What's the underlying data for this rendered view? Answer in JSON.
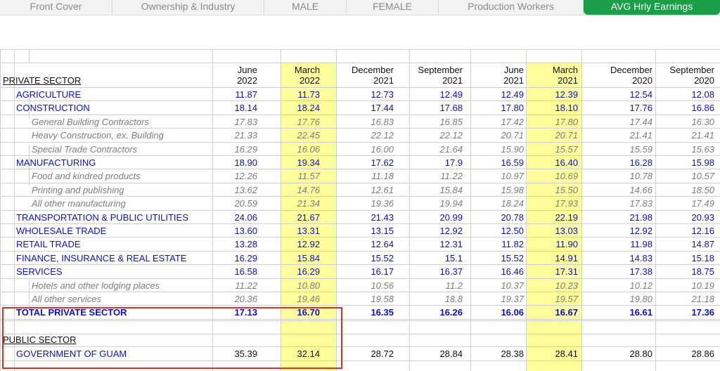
{
  "tabs": [
    {
      "label": "Front Cover",
      "active": false
    },
    {
      "label": "Ownership & Industry",
      "active": false
    },
    {
      "label": "MALE",
      "active": false
    },
    {
      "label": "FEMALE",
      "active": false
    },
    {
      "label": "Production Workers",
      "active": false
    },
    {
      "label": "AVG Hrly Earnings",
      "active": true
    }
  ],
  "sections": {
    "private": "PRIVATE SECTOR",
    "public": "PUBLIC SECTOR"
  },
  "columns": [
    {
      "month": "June",
      "year": "2022",
      "highlight": false
    },
    {
      "month": "March",
      "year": "2022",
      "highlight": true
    },
    {
      "month": "December",
      "year": "2021",
      "highlight": false
    },
    {
      "month": "September",
      "year": "2021",
      "highlight": false
    },
    {
      "month": "June",
      "year": "2021",
      "highlight": false
    },
    {
      "month": "March",
      "year": "2021",
      "highlight": true
    },
    {
      "month": "December",
      "year": "2020",
      "highlight": false
    },
    {
      "month": "September",
      "year": "2020",
      "highlight": false
    }
  ],
  "rows": [
    {
      "label": "AGRICULTURE",
      "style": "main",
      "values": [
        "11.87",
        "11.73",
        "12.73",
        "12.49",
        "12.49",
        "12.39",
        "12.54",
        "12.08"
      ]
    },
    {
      "label": "CONSTRUCTION",
      "style": "main",
      "values": [
        "18.14",
        "18.24",
        "17.44",
        "17.68",
        "17.80",
        "18.10",
        "17.76",
        "16.86"
      ]
    },
    {
      "label": "General Building Contractors",
      "style": "sub",
      "values": [
        "17.83",
        "17.76",
        "16.83",
        "16.85",
        "17.42",
        "17.80",
        "17.44",
        "16.30"
      ]
    },
    {
      "label": "Heavy Construction, ex. Building",
      "style": "sub",
      "values": [
        "21.33",
        "22.45",
        "22.12",
        "22.12",
        "20.71",
        "20.71",
        "21.41",
        "21.41"
      ]
    },
    {
      "label": "Special Trade Contractors",
      "style": "sub",
      "values": [
        "16.29",
        "16.06",
        "16.00",
        "21.64",
        "15.90",
        "15.57",
        "15.59",
        "15.63"
      ]
    },
    {
      "label": "MANUFACTURING",
      "style": "main",
      "values": [
        "18.90",
        "19.34",
        "17.62",
        "17.9",
        "16.59",
        "16.40",
        "16.28",
        "15.98"
      ]
    },
    {
      "label": "Food and kindred products",
      "style": "sub",
      "values": [
        "12.26",
        "11.57",
        "11.18",
        "11.22",
        "10.97",
        "10.69",
        "10.78",
        "10.57"
      ]
    },
    {
      "label": "Printing and publishing",
      "style": "sub",
      "values": [
        "13.62",
        "14.76",
        "12.61",
        "15.84",
        "15.98",
        "15.50",
        "14.66",
        "18.50"
      ]
    },
    {
      "label": "All other manufacturing",
      "style": "sub",
      "values": [
        "20.59",
        "21.34",
        "19.36",
        "19.94",
        "18.24",
        "17.93",
        "17.83",
        "17.49"
      ]
    },
    {
      "label": "TRANSPORTATION & PUBLIC UTILITIES",
      "style": "main",
      "values": [
        "24.06",
        "21.67",
        "21.43",
        "20.99",
        "20.78",
        "22.19",
        "21.98",
        "20.93"
      ]
    },
    {
      "label": "WHOLESALE TRADE",
      "style": "main",
      "values": [
        "13.60",
        "13.31",
        "13.15",
        "12.92",
        "12.50",
        "13.03",
        "12.92",
        "12.16"
      ]
    },
    {
      "label": "RETAIL TRADE",
      "style": "main",
      "values": [
        "13.28",
        "12.92",
        "12.64",
        "12.31",
        "11.82",
        "11.90",
        "11.98",
        "14.87"
      ]
    },
    {
      "label": "FINANCE, INSURANCE & REAL ESTATE",
      "style": "main",
      "values": [
        "16.29",
        "15.84",
        "15.52",
        "15.1",
        "15.52",
        "14.91",
        "14.83",
        "15.18"
      ]
    },
    {
      "label": "SERVICES",
      "style": "main",
      "values": [
        "16.58",
        "16.29",
        "16.17",
        "16.37",
        "16.46",
        "17.31",
        "17.38",
        "18.75"
      ]
    },
    {
      "label": "Hotels and other lodging places",
      "style": "sub",
      "values": [
        "11.22",
        "10.80",
        "10.56",
        "11.2",
        "10.37",
        "10.23",
        "10.12",
        "10.19"
      ]
    },
    {
      "label": "All other services",
      "style": "sub",
      "values": [
        "20.36",
        "19.46",
        "19.58",
        "18.8",
        "19.37",
        "19.57",
        "19.80",
        "21.18"
      ]
    },
    {
      "label": "TOTAL PRIVATE SECTOR",
      "style": "total",
      "values": [
        "17.13",
        "16.70",
        "16.35",
        "16.26",
        "16.06",
        "16.67",
        "16.61",
        "17.36"
      ]
    }
  ],
  "public_rows": [
    {
      "label": "GOVERNMENT OF GUAM",
      "style": "public",
      "values": [
        "35.39",
        "32.14",
        "28.72",
        "28.84",
        "28.38",
        "28.41",
        "28.80",
        "28.86"
      ]
    }
  ],
  "colors": {
    "highlight": "#fdfd9c",
    "active_tab": "#1a9e48",
    "data_blue": "#0c10d0",
    "callout_red": "#e0301f"
  }
}
